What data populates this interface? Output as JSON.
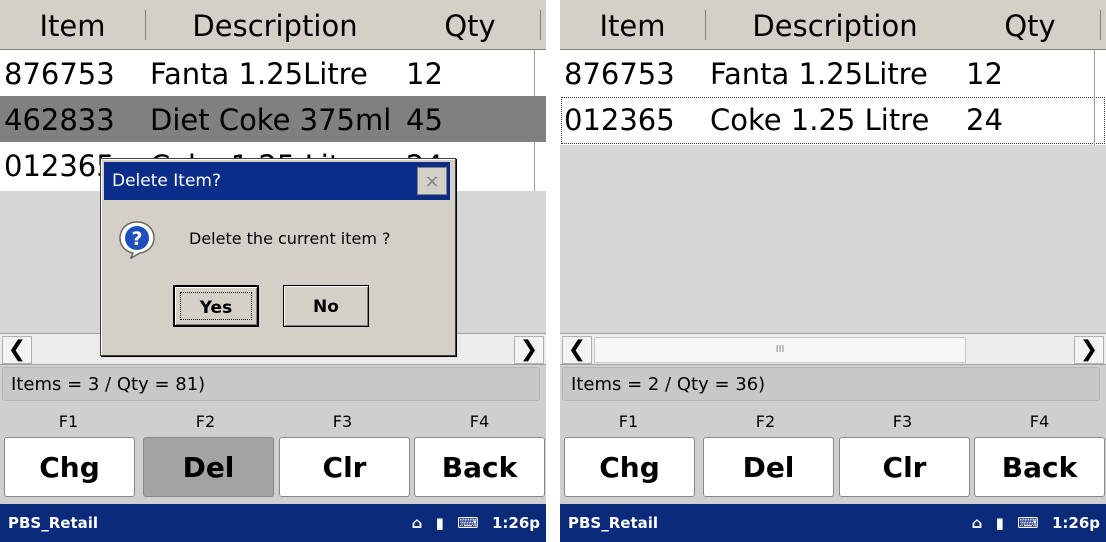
{
  "left": {
    "columns": [
      "Item",
      "Description",
      "Qty"
    ],
    "rows": [
      {
        "item": "876753",
        "description": "Fanta 1.25Litre",
        "qty": "12"
      },
      {
        "item": "462833",
        "description": "Diet Coke 375ml",
        "qty": "45"
      },
      {
        "item": "012365",
        "description": "Coke 1.25 Litre",
        "qty": "24"
      }
    ],
    "status": "Items = 3 / Qty = 81)",
    "function_keys": [
      "F1",
      "F2",
      "F3",
      "F4"
    ],
    "buttons": [
      "Chg",
      "Del",
      "Clr",
      "Back"
    ],
    "taskbar": {
      "title": "PBS_Retail",
      "time": "1:26p"
    },
    "dialog": {
      "title": "Delete Item?",
      "close": "×",
      "message": "Delete the current item ?",
      "yes": "Yes",
      "no": "No",
      "icon": "question-icon"
    }
  },
  "right": {
    "columns": [
      "Item",
      "Description",
      "Qty"
    ],
    "rows": [
      {
        "item": "876753",
        "description": "Fanta 1.25Litre",
        "qty": "12"
      },
      {
        "item": "012365",
        "description": "Coke 1.25 Litre",
        "qty": "24"
      }
    ],
    "status": "Items = 2 / Qty = 36)",
    "function_keys": [
      "F1",
      "F2",
      "F3",
      "F4"
    ],
    "buttons": [
      "Chg",
      "Del",
      "Clr",
      "Back"
    ],
    "taskbar": {
      "title": "PBS_Retail",
      "time": "1:26p"
    },
    "scroll_thumb": "III"
  },
  "colors": {
    "taskbar": "#0a2a7a",
    "dialog_title": "#0b2d8a",
    "selected_row": "#808080"
  }
}
